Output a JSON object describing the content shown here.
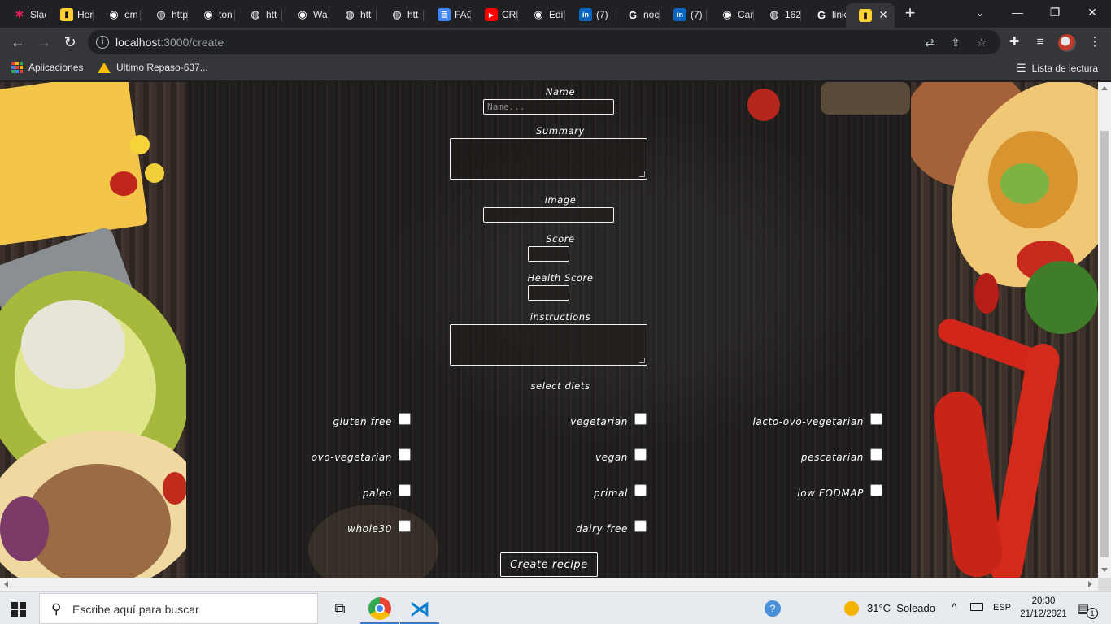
{
  "browser": {
    "tabs": [
      {
        "label": "Slac",
        "icon": "slack-icon",
        "color": "#e01e5a"
      },
      {
        "label": "Her",
        "icon": "miro-icon",
        "color": "#ffd02f"
      },
      {
        "label": "em",
        "icon": "github-icon",
        "color": "#ffffff"
      },
      {
        "label": "http",
        "icon": "globe-icon",
        "color": "#ffffff"
      },
      {
        "label": "ton",
        "icon": "github-icon",
        "color": "#ffffff"
      },
      {
        "label": "htt",
        "icon": "globe-icon",
        "color": "#ffffff"
      },
      {
        "label": "Wa",
        "icon": "github-icon",
        "color": "#ffffff"
      },
      {
        "label": "htt",
        "icon": "globe-icon",
        "color": "#ffffff"
      },
      {
        "label": "htt",
        "icon": "globe-icon",
        "color": "#ffffff"
      },
      {
        "label": "FAC",
        "icon": "docs-icon",
        "color": "#4285f4"
      },
      {
        "label": "CRI",
        "icon": "youtube-icon",
        "color": "#ff0000"
      },
      {
        "label": "Edi",
        "icon": "github-icon",
        "color": "#ffffff"
      },
      {
        "label": "(7)",
        "icon": "linkedin-icon",
        "color": "#0a66c2"
      },
      {
        "label": "noc",
        "icon": "google-icon",
        "color": "#ffffff"
      },
      {
        "label": "(7)",
        "icon": "linkedin-icon",
        "color": "#0a66c2"
      },
      {
        "label": "Car",
        "icon": "github-icon",
        "color": "#ffffff"
      },
      {
        "label": "162",
        "icon": "globe-icon",
        "color": "#ffffff"
      },
      {
        "label": "link",
        "icon": "google-icon",
        "color": "#ffffff"
      },
      {
        "label": "",
        "icon": "miro-icon",
        "color": "#ffd02f"
      }
    ],
    "url_host": "localhost",
    "url_path": ":3000/create",
    "bookmarks": {
      "apps": "Aplicaciones",
      "drive_item": "Ultimo Repaso-637...",
      "reading_list": "Lista de lectura"
    }
  },
  "form": {
    "name_label": "Name",
    "name_placeholder": "Name...",
    "summary_label": "Summary",
    "image_label": "image",
    "score_label": "Score",
    "health_score_label": "Health Score",
    "instructions_label": "instructions",
    "diets_label": "select diets",
    "diets": [
      "gluten free",
      "vegetarian",
      "lacto-ovo-vegetarian",
      "ovo-vegetarian",
      "vegan",
      "pescatarian",
      "paleo",
      "primal",
      "low FODMAP",
      "whole30",
      "dairy free"
    ],
    "submit_label": "Create recipe"
  },
  "taskbar": {
    "search_placeholder": "Escribe aquí para buscar",
    "weather": "31°C  Soleado",
    "language": "ESP",
    "time": "20:30",
    "date": "21/12/2021",
    "notifications": "1"
  }
}
